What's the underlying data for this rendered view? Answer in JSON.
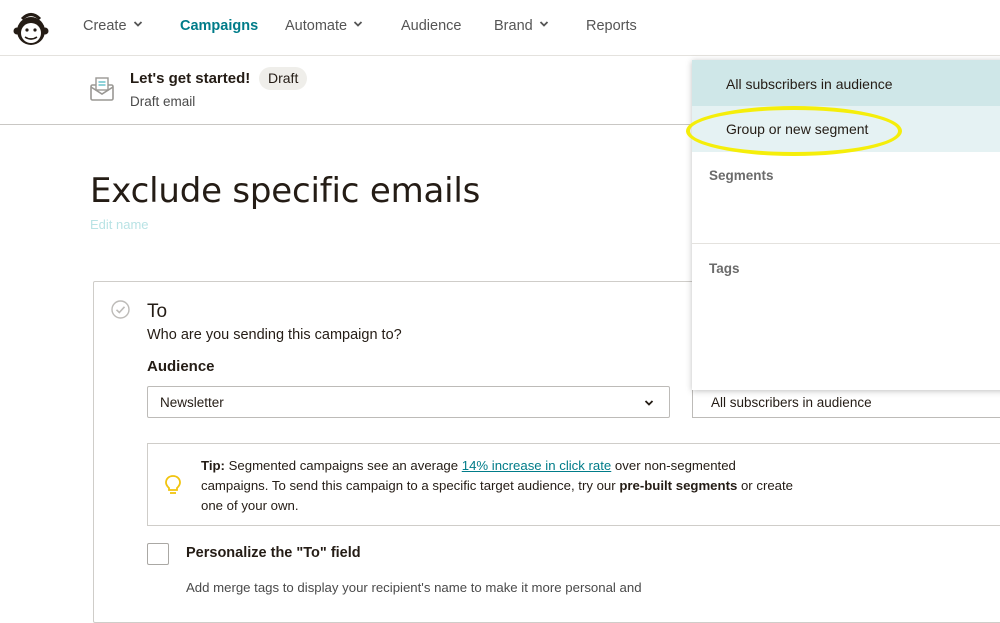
{
  "nav": {
    "logo_icon": "mailchimp-freddie-icon",
    "items": [
      {
        "label": "Create",
        "dropdown": true,
        "active": false
      },
      {
        "label": "Campaigns",
        "dropdown": false,
        "active": true
      },
      {
        "label": "Automate",
        "dropdown": true,
        "active": false
      },
      {
        "label": "Audience",
        "dropdown": false,
        "active": false
      },
      {
        "label": "Brand",
        "dropdown": true,
        "active": false
      },
      {
        "label": "Reports",
        "dropdown": false,
        "active": false
      }
    ]
  },
  "header": {
    "title": "Let's get started!",
    "badge": "Draft",
    "subtitle": "Draft email",
    "icon": "envelope-icon"
  },
  "page": {
    "title": "Exclude specific emails",
    "edit_name": "Edit name"
  },
  "to_section": {
    "title": "To",
    "subtitle": "Who are you sending this campaign to?",
    "audience_label": "Audience",
    "audience_value": "Newsletter",
    "segment_value": "All subscribers in audience"
  },
  "tip": {
    "label": "Tip:",
    "text_before": " Segmented campaigns see an average ",
    "link": "14% increase in click rate",
    "text_after": " over non-segmented campaigns. To send this campaign to a specific target audience, try our ",
    "bold": "pre-built segments",
    "text_end": " or create one of your own."
  },
  "personalize": {
    "title": "Personalize the \"To\" field",
    "description": "Add merge tags to display your recipient's name to make it more personal and"
  },
  "dropdown": {
    "option_all": "All subscribers in audience",
    "option_group": "Group or new segment",
    "group_segments": "Segments",
    "group_tags": "Tags"
  },
  "colors": {
    "accent": "#007c89",
    "highlight": "#f5ee0a",
    "selected_option": "#cfe7e8"
  }
}
